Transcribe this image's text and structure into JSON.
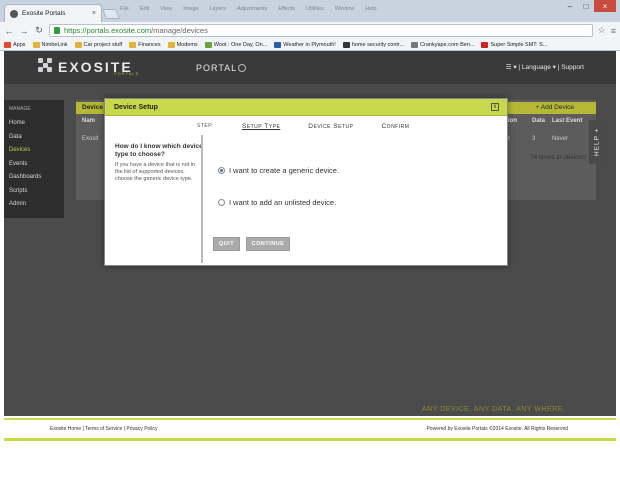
{
  "browser": {
    "tab_title": "Exosite Portals",
    "url_host": "https://portals.exosite.com",
    "url_path": "/manage/devices",
    "background_menu": [
      "File",
      "Edit",
      "View",
      "Image",
      "Layers",
      "Adjustments",
      "Effects",
      "Utilities",
      "Window",
      "Help"
    ],
    "bookmarks": [
      {
        "label": "Apps",
        "color": "#e24a33"
      },
      {
        "label": "NimbeLink",
        "color": "#e0b33c"
      },
      {
        "label": "Car project stuff",
        "color": "#e0b33c"
      },
      {
        "label": "Finances",
        "color": "#e0b33c"
      },
      {
        "label": "Modems",
        "color": "#e0b33c"
      },
      {
        "label": "Woot : One Day, On...",
        "color": "#6aa53c"
      },
      {
        "label": "Weather in Plymouth!",
        "color": "#2b5da8"
      },
      {
        "label": "home security contr...",
        "color": "#333333"
      },
      {
        "label": "Crankyape.com Ben...",
        "color": "#777777"
      },
      {
        "label": "Super Simple SMT: S...",
        "color": "#cc2222"
      }
    ]
  },
  "site": {
    "logo_text": "EXOSITE",
    "logo_sub": "PORTALS",
    "portal_label": "PORTAL",
    "header_right": "☰ ▾ | Language ▾ | Support",
    "sidebar_heading": "MANAGE",
    "sidebar_items": [
      "Home",
      "Data",
      "Devices",
      "Events",
      "Dashboards",
      "Scripts",
      "Admin"
    ],
    "active_item": "Devices",
    "content_title": "Device",
    "add_device": "+ Add Device",
    "columns": [
      "Nam",
      "tion",
      "Data",
      "Last Event"
    ],
    "row": [
      "Exosit",
      "r",
      "3",
      "Never"
    ],
    "background_note": "74 times in devices' timez",
    "help_tab": "HELP +",
    "tagline": "ANY DEVICE. ANY DATA. ANY WHERE.",
    "footer_links": "Exosite Home | Terms of Service | Privacy Policy",
    "footer_copy": "Powered by Exosite Portals ©2014 Exosite. All Rights Reserved"
  },
  "modal": {
    "title": "Device Setup",
    "close": "x",
    "step_label": "STEP:",
    "steps": [
      "Setup Type",
      "Device Setup",
      "Confirm"
    ],
    "question": "How do I know which device type to choose?",
    "question_desc": "If you have a device that is not in the list of supported devices, choose the generic device type.",
    "options": [
      {
        "label": "I want to create a generic device.",
        "checked": true
      },
      {
        "label": "I want to add an unlisted device.",
        "checked": false
      }
    ],
    "quit_label": "QUIT",
    "continue_label": "CONTINUE"
  },
  "colors": {
    "accent": "#c7d84a",
    "header_bg": "#3a3a3a",
    "overlay_bg": "#4b4b4b"
  }
}
